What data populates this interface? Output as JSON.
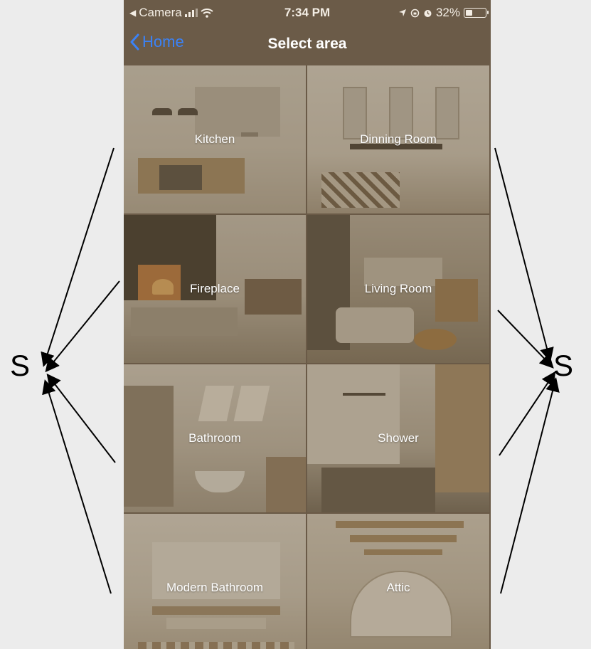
{
  "status_bar": {
    "carrier": "Camera",
    "time": "7:34 PM",
    "battery": "32%"
  },
  "nav": {
    "back_label": "Home",
    "title": "Select area"
  },
  "tiles": [
    {
      "label": "Kitchen"
    },
    {
      "label": "Dinning Room"
    },
    {
      "label": "Fireplace"
    },
    {
      "label": "Living Room"
    },
    {
      "label": "Bathroom"
    },
    {
      "label": "Shower"
    },
    {
      "label": "Modern Bathroom"
    },
    {
      "label": "Attic"
    }
  ],
  "annotations": {
    "left_label": "S",
    "right_label": "S"
  }
}
